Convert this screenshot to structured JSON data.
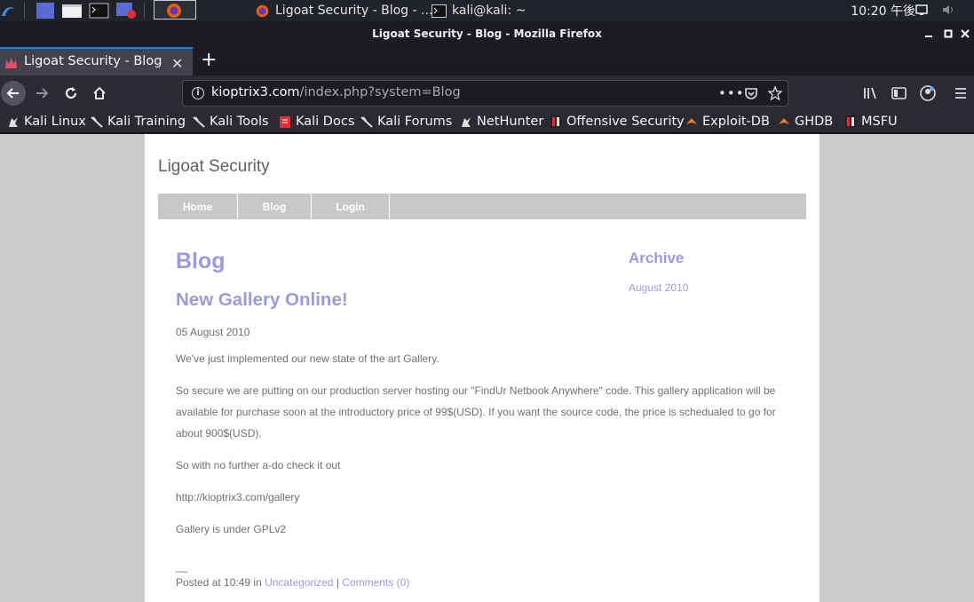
{
  "taskbar": {
    "windows": [
      {
        "label": "Ligoat Security - Blog - ..."
      },
      {
        "label": "kali@kali: ~"
      }
    ],
    "clock": "10:20 午後"
  },
  "firefox": {
    "window_title": "Ligoat Security - Blog - Mozilla Firefox",
    "tab_title": "Ligoat Security - Blog",
    "url_host": "kioptrix3.com",
    "url_path": "/index.php?system=Blog",
    "bookmarks": [
      {
        "label": "Kali Linux",
        "icon": "kali-dragon-icon"
      },
      {
        "label": "Kali Training",
        "icon": "kali-dragon-icon"
      },
      {
        "label": "Kali Tools",
        "icon": "kali-dragon-icon"
      },
      {
        "label": "Kali Docs",
        "icon": "kali-docs-icon"
      },
      {
        "label": "Kali Forums",
        "icon": "kali-dragon-icon"
      },
      {
        "label": "NetHunter",
        "icon": "kali-dragon-icon"
      },
      {
        "label": "Offensive Security",
        "icon": "offsec-icon"
      },
      {
        "label": "Exploit-DB",
        "icon": "exploitdb-icon"
      },
      {
        "label": "GHDB",
        "icon": "exploitdb-icon"
      },
      {
        "label": "MSFU",
        "icon": "offsec-icon"
      }
    ]
  },
  "site": {
    "title": "Ligoat Security",
    "menu": [
      "Home",
      "Blog",
      "Login"
    ],
    "heading": "Blog",
    "post": {
      "title": "New Gallery Online!",
      "date": "05 August 2010",
      "paragraphs": [
        "We've just implemented our new state of the art Gallery.",
        "So secure we are putting on our production server hosting our \"FindUr Netbook Anywhere\" code. This gallery application will be available for purchase soon at the introductory price of 99$(USD). If you want the source code, the price is schedualed to go for about 900$(USD).",
        "So with no further a-do check it out",
        "http://kioptrix3.com/gallery",
        "Gallery is under GPLv2"
      ],
      "separator": "__",
      "meta_prefix": "Posted at 10:49 in",
      "category": "Uncategorized",
      "meta_sep": "|",
      "comments": "Comments (0)"
    },
    "sidebar": {
      "heading": "Archive",
      "link": "August 2010"
    }
  },
  "colors": {
    "accent_link": "#9a9ae0",
    "menu_bg": "#c8c8c8",
    "page_bg": "#cccccc",
    "tab_accent": "#0a84ff"
  }
}
